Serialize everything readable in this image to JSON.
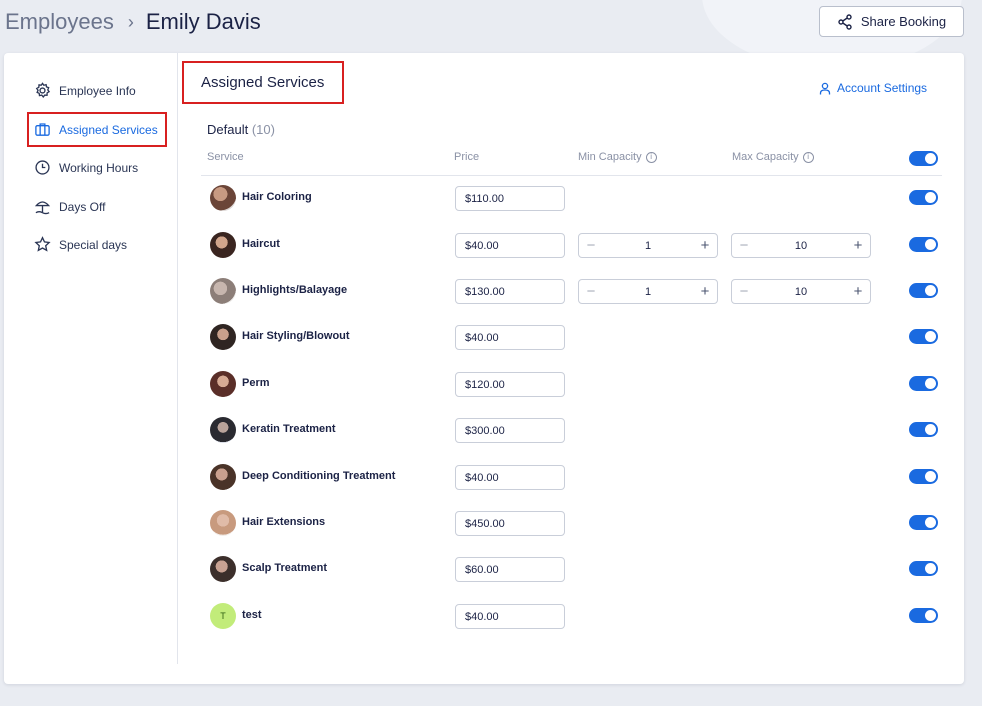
{
  "breadcrumb": {
    "root": "Employees",
    "separator": "›",
    "current": "Emily Davis"
  },
  "share_button": {
    "label": "Share Booking",
    "icon": "share-icon"
  },
  "sidebar": {
    "items": [
      {
        "label": "Employee Info",
        "icon": "gear-icon",
        "active": false
      },
      {
        "label": "Assigned Services",
        "icon": "briefcase-icon",
        "active": true
      },
      {
        "label": "Working Hours",
        "icon": "clock-icon",
        "active": false
      },
      {
        "label": "Days Off",
        "icon": "beach-umbrella-icon",
        "active": false
      },
      {
        "label": "Special days",
        "icon": "star-icon",
        "active": false
      }
    ]
  },
  "main": {
    "title": "Assigned Services",
    "account_settings": {
      "label": "Account Settings",
      "icon": "user-icon"
    },
    "group": {
      "name": "Default",
      "count": "(10)"
    },
    "columns": {
      "service": "Service",
      "price": "Price",
      "min_capacity": "Min Capacity",
      "max_capacity": "Max Capacity"
    },
    "header_toggle_on": true,
    "services": [
      {
        "name": "Hair Coloring",
        "price": "$110.00",
        "enabled": true
      },
      {
        "name": "Haircut",
        "price": "$40.00",
        "min": "1",
        "max": "10",
        "enabled": true
      },
      {
        "name": "Highlights/Balayage",
        "price": "$130.00",
        "min": "1",
        "max": "10",
        "enabled": true
      },
      {
        "name": "Hair Styling/Blowout",
        "price": "$40.00",
        "enabled": true
      },
      {
        "name": "Perm",
        "price": "$120.00",
        "enabled": true
      },
      {
        "name": "Keratin Treatment",
        "price": "$300.00",
        "enabled": true
      },
      {
        "name": "Deep Conditioning Treatment",
        "price": "$40.00",
        "enabled": true
      },
      {
        "name": "Hair Extensions",
        "price": "$450.00",
        "enabled": true
      },
      {
        "name": "Scalp Treatment",
        "price": "$60.00",
        "enabled": true
      },
      {
        "name": "test",
        "price": "$40.00",
        "enabled": true,
        "initial": "T"
      }
    ]
  },
  "colors": {
    "accent": "#1a6ae0",
    "highlight_border": "#d82020",
    "text_dark": "#1b2245",
    "muted": "#8a91a5"
  }
}
